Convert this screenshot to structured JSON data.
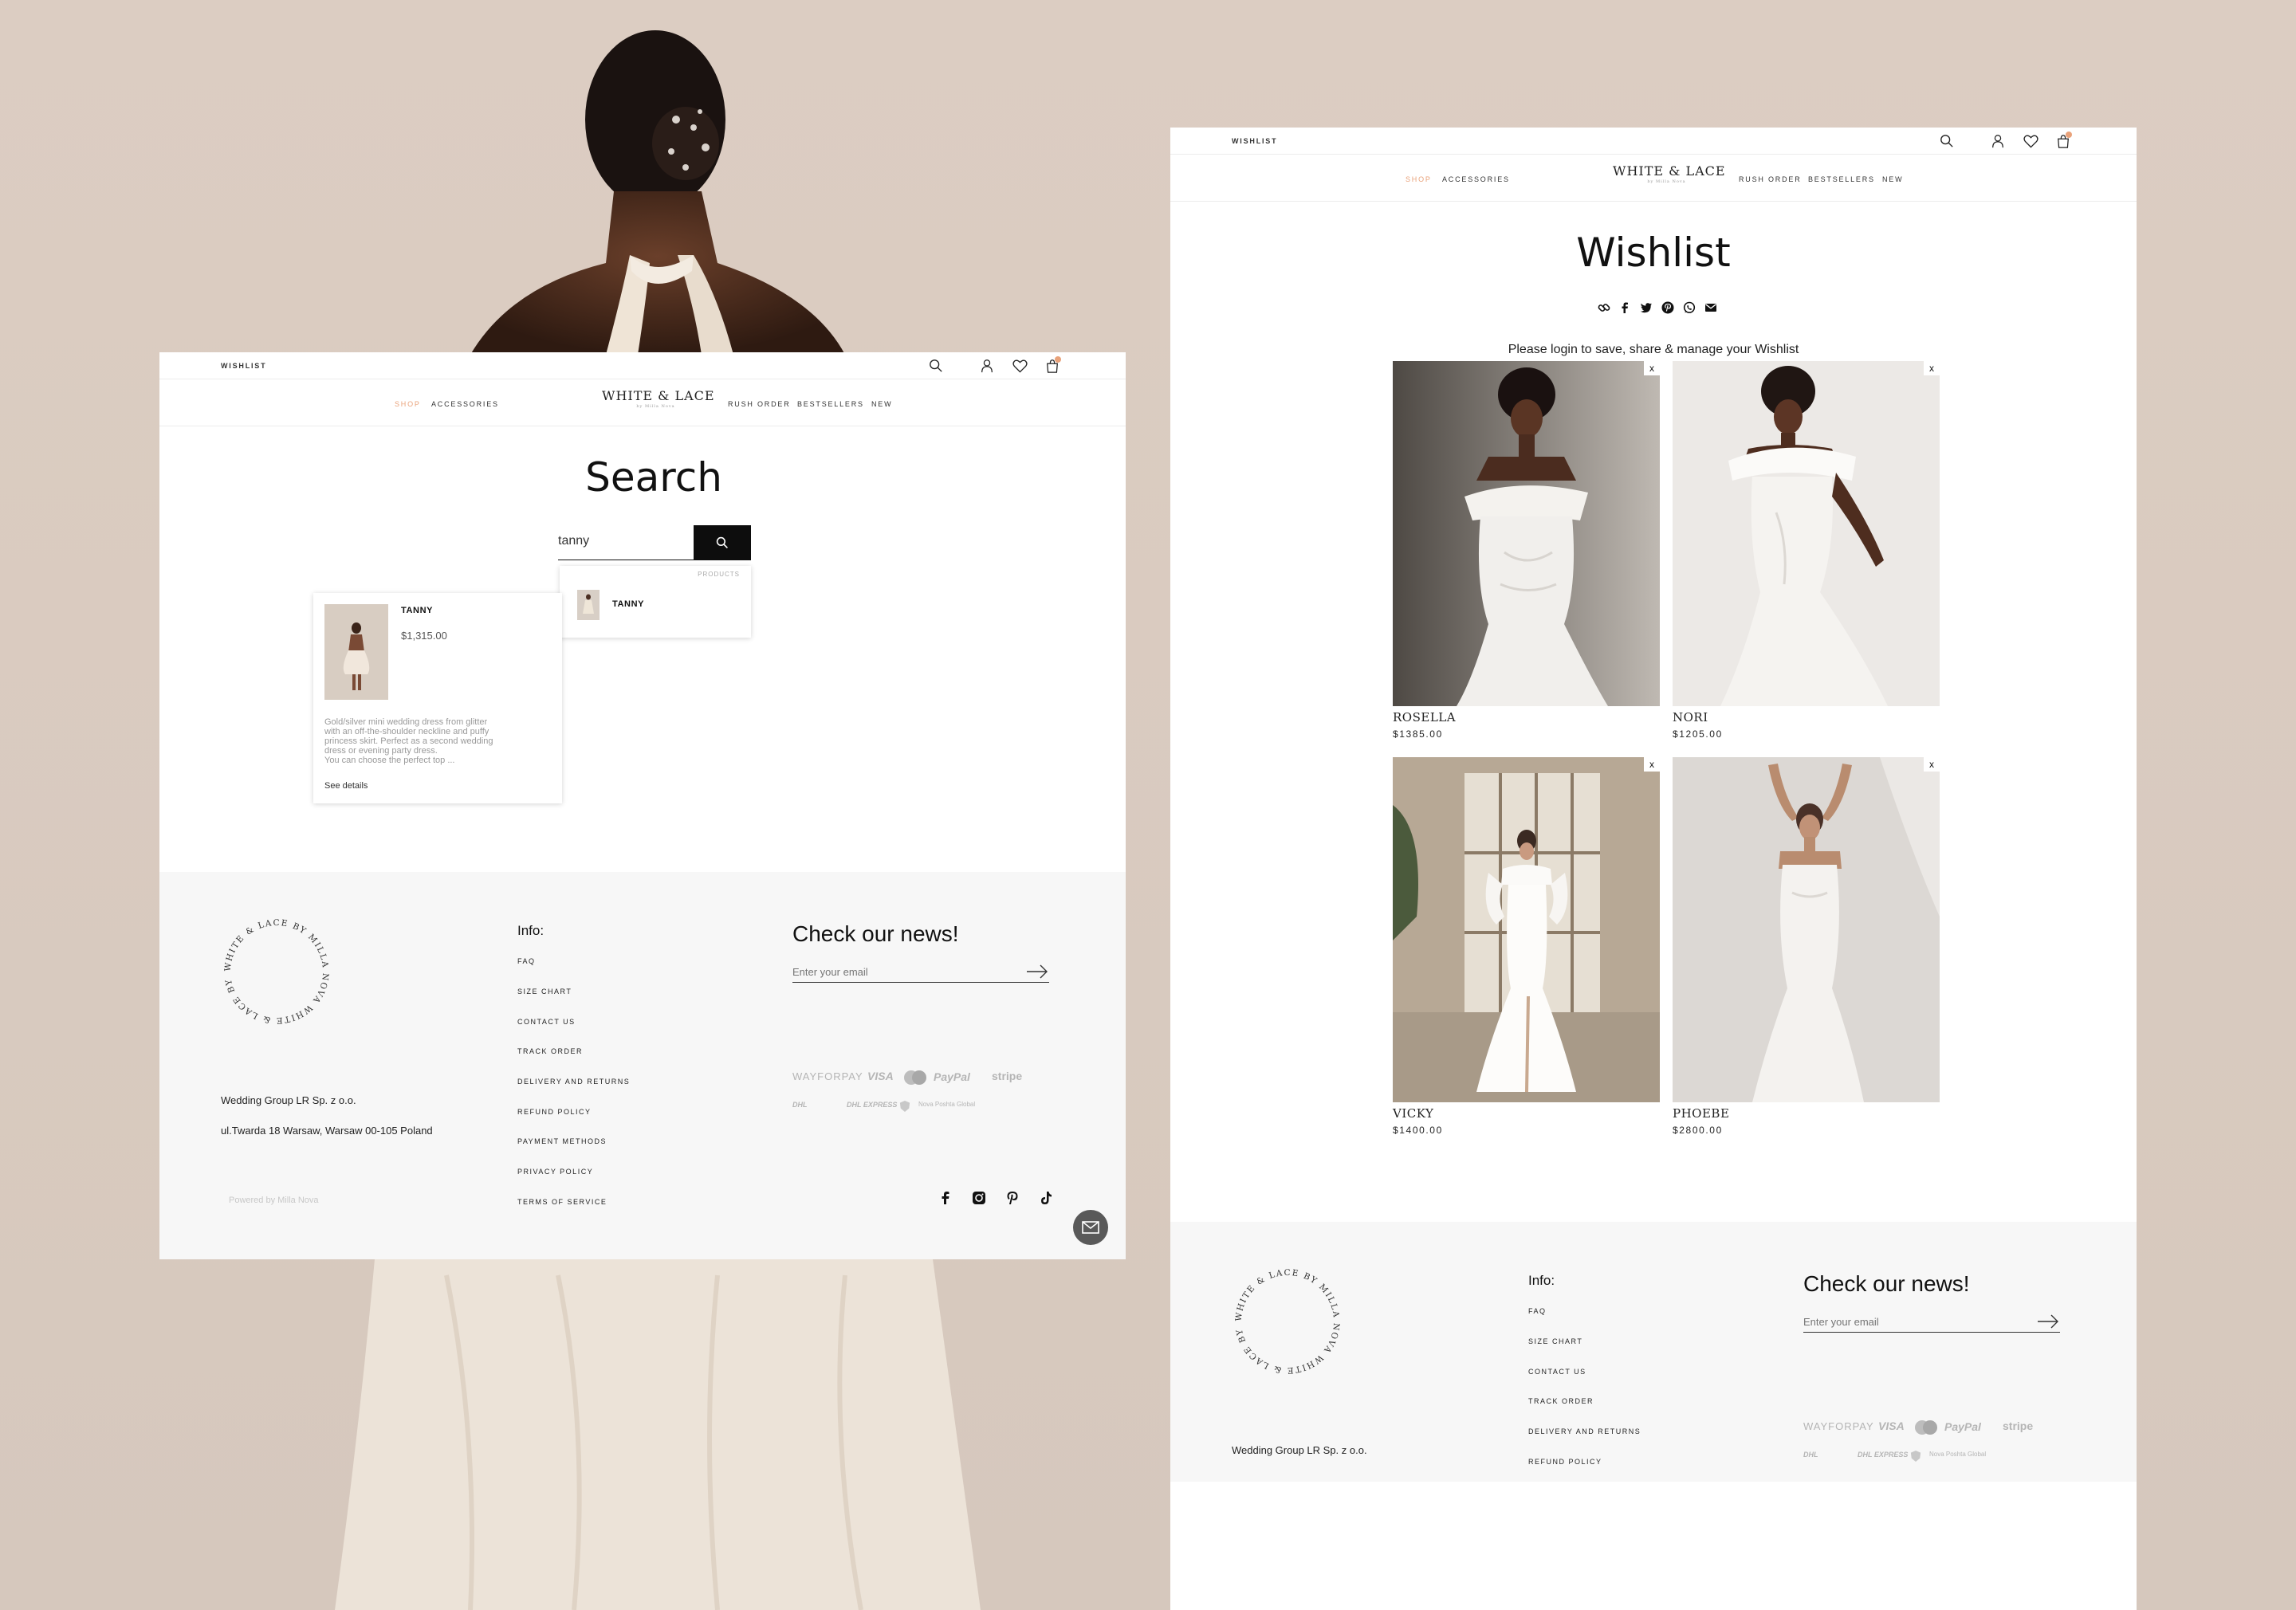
{
  "search_page": {
    "topbar": {
      "wishlist_label": "WISHLIST"
    },
    "nav": {
      "shop": "SHOP",
      "accessories": "ACCESSORIES",
      "rush_order": "RUSH ORDER",
      "bestsellers": "BESTSELLERS",
      "new": "NEW"
    },
    "logo": {
      "title": "WHITE & LACE",
      "sub": "by Milla Nova"
    },
    "title": "Search",
    "search": {
      "value": "tanny"
    },
    "dropdown": {
      "heading": "PRODUCTS",
      "product_name": "TANNY"
    },
    "card": {
      "name": "TANNY",
      "price": "$1,315.00",
      "description": [
        "Gold/silver mini wedding dress from glitter",
        "with an off-the-shoulder neckline and puffy",
        "princess skirt. Perfect as a second wedding",
        "dress or evening party dress.",
        "You can choose the perfect top ..."
      ],
      "see_details": "See details"
    }
  },
  "wishlist_page": {
    "topbar": {
      "wishlist_label": "WISHLIST"
    },
    "nav": {
      "shop": "SHOP",
      "accessories": "ACCESSORIES",
      "rush_order": "RUSH ORDER",
      "bestsellers": "BESTSELLERS",
      "new": "NEW"
    },
    "logo": {
      "title": "WHITE & LACE",
      "sub": "by Milla Nova"
    },
    "title": "Wishlist",
    "login_msg": "Please login to save, share & manage your Wishlist",
    "items": [
      {
        "name": "ROSELLA",
        "price": "$1385.00"
      },
      {
        "name": "NORI",
        "price": "$1205.00"
      },
      {
        "name": "VICKY",
        "price": "$1400.00"
      },
      {
        "name": "PHOEBE",
        "price": "$2800.00"
      }
    ],
    "remove_label": "x"
  },
  "footer": {
    "seal_text": "WHITE & LACE BY MILLA NOVA WHITE & LACE BY MILLA NOVA",
    "info_title": "Info:",
    "links": [
      "FAQ",
      "SIZE CHART",
      "CONTACT US",
      "TRACK ORDER",
      "DELIVERY AND RETURNS",
      "REFUND POLICY",
      "PAYMENT METHODS",
      "PRIVACY POLICY",
      "TERMS OF SERVICE"
    ],
    "news_title": "Check our news!",
    "email_placeholder": "Enter your email",
    "company": "Wedding Group LR Sp. z o.o.",
    "address": "ul.Twarda 18 Warsaw, Warsaw 00-105 Poland",
    "powered": "Powered by Milla Nova",
    "payments": {
      "wayforpay": "WAYFORPAY",
      "visa": "VISA",
      "paypal": "PayPal",
      "stripe": "stripe",
      "dhl": "DHL",
      "dhl_express": "DHL EXPRESS",
      "nova": "Nova Poshta Global"
    }
  },
  "colors": {
    "accent": "#e9a27a",
    "background": "#ddd0c6",
    "footer": "#f7f7f7"
  }
}
